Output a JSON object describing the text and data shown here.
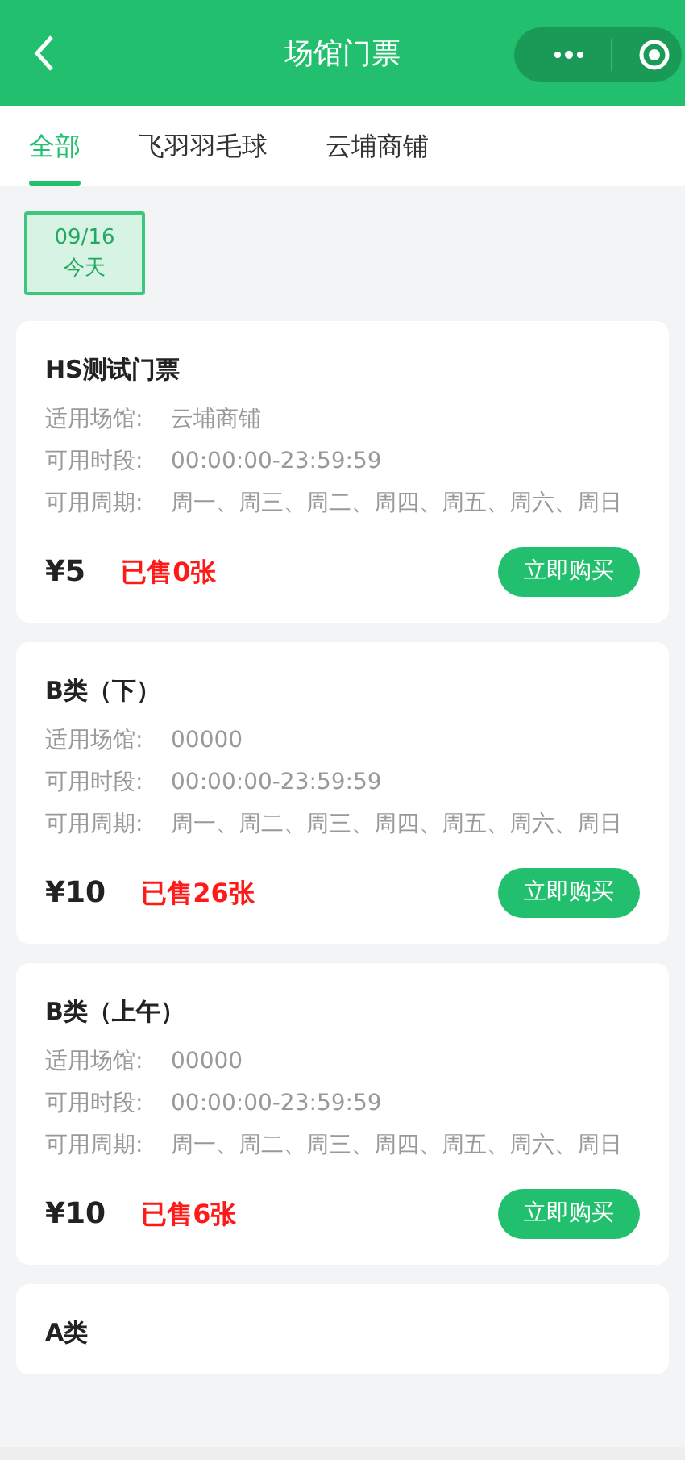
{
  "header": {
    "title": "场馆门票"
  },
  "tabs": [
    {
      "label": "全部",
      "selected": true
    },
    {
      "label": "飞羽羽毛球",
      "selected": false
    },
    {
      "label": "云埔商铺",
      "selected": false
    }
  ],
  "dates": [
    {
      "date": "09/16",
      "day": "今天",
      "selected": true
    }
  ],
  "tickets": [
    {
      "title": "HS测试门票",
      "fields": [
        {
          "label": "适用场馆:",
          "value": "云埔商铺"
        },
        {
          "label": "可用时段:",
          "value": "00:00:00-23:59:59"
        },
        {
          "label": "可用周期:",
          "value": "周一、周三、周二、周四、周五、周六、周日"
        }
      ],
      "price": "¥5",
      "sold": "已售0张",
      "button": "立即购买"
    },
    {
      "title": "B类（下）",
      "fields": [
        {
          "label": "适用场馆:",
          "value": "00000"
        },
        {
          "label": "可用时段:",
          "value": "00:00:00-23:59:59"
        },
        {
          "label": "可用周期:",
          "value": "周一、周二、周三、周四、周五、周六、周日"
        }
      ],
      "price": "¥10",
      "sold": "已售26张",
      "button": "立即购买"
    },
    {
      "title": "B类（上午）",
      "fields": [
        {
          "label": "适用场馆:",
          "value": "00000"
        },
        {
          "label": "可用时段:",
          "value": "00:00:00-23:59:59"
        },
        {
          "label": "可用周期:",
          "value": "周一、周二、周三、周四、周五、周六、周日"
        }
      ],
      "price": "¥10",
      "sold": "已售6张",
      "button": "立即购买"
    },
    {
      "title": "A类"
    }
  ]
}
